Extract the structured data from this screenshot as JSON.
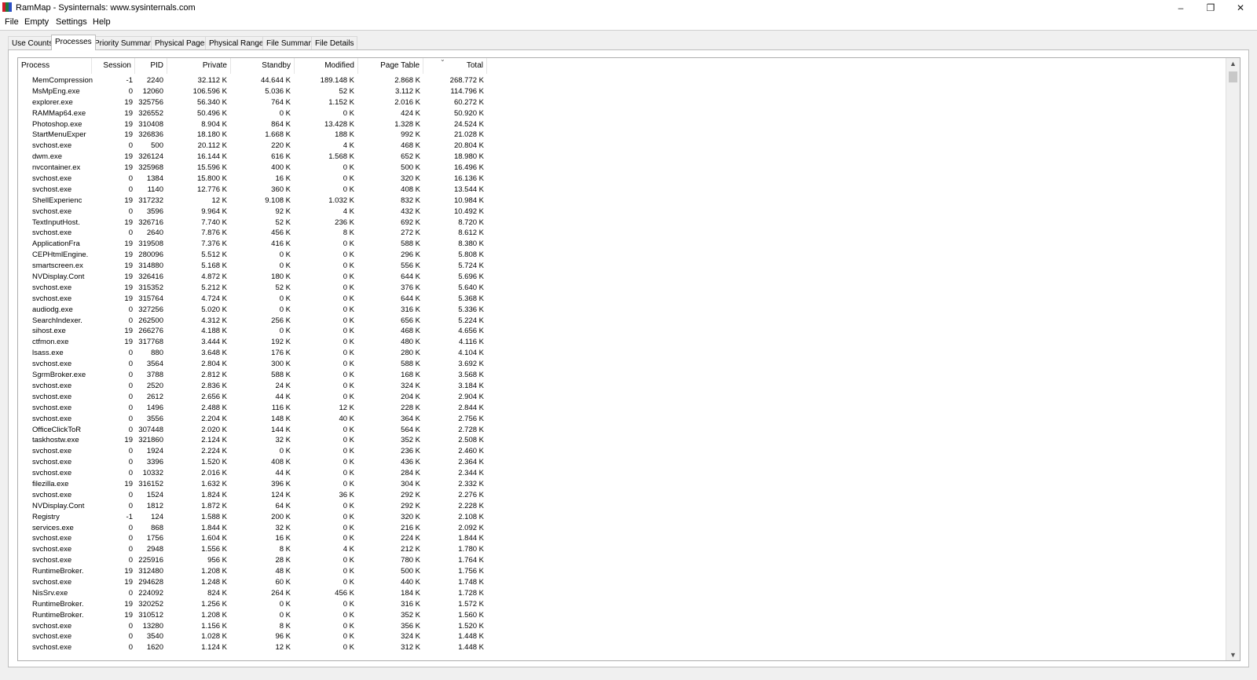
{
  "window": {
    "title": "RamMap - Sysinternals: www.sysinternals.com",
    "minimize_glyph": "–",
    "restore_glyph": "❐",
    "close_glyph": "✕",
    "icon_colors": [
      "#d01c2b",
      "#1f7a3a",
      "#2b4fc4"
    ]
  },
  "menu": [
    "File",
    "Empty",
    "Settings",
    "Help"
  ],
  "tabs": [
    "Use Counts",
    "Processes",
    "Priority Summary",
    "Physical Pages",
    "Physical Ranges",
    "File Summary",
    "File Details"
  ],
  "active_tab": "Processes",
  "table": {
    "columns": [
      "Process",
      "Session",
      "PID",
      "Private",
      "Standby",
      "Modified",
      "Page Table",
      "Total"
    ],
    "sorted_column": "Total",
    "rows": [
      [
        "MemCompression",
        "-1",
        "2240",
        "32.112 K",
        "44.644 K",
        "189.148 K",
        "2.868 K",
        "268.772 K"
      ],
      [
        "MsMpEng.exe",
        "0",
        "12060",
        "106.596 K",
        "5.036 K",
        "52 K",
        "3.112 K",
        "114.796 K"
      ],
      [
        "explorer.exe",
        "19",
        "325756",
        "56.340 K",
        "764 K",
        "1.152 K",
        "2.016 K",
        "60.272 K"
      ],
      [
        "RAMMap64.exe",
        "19",
        "326552",
        "50.496 K",
        "0 K",
        "0 K",
        "424 K",
        "50.920 K"
      ],
      [
        "Photoshop.exe",
        "19",
        "310408",
        "8.904 K",
        "864 K",
        "13.428 K",
        "1.328 K",
        "24.524 K"
      ],
      [
        "StartMenuExper",
        "19",
        "326836",
        "18.180 K",
        "1.668 K",
        "188 K",
        "992 K",
        "21.028 K"
      ],
      [
        "svchost.exe",
        "0",
        "500",
        "20.112 K",
        "220 K",
        "4 K",
        "468 K",
        "20.804 K"
      ],
      [
        "dwm.exe",
        "19",
        "326124",
        "16.144 K",
        "616 K",
        "1.568 K",
        "652 K",
        "18.980 K"
      ],
      [
        "nvcontainer.ex",
        "19",
        "325968",
        "15.596 K",
        "400 K",
        "0 K",
        "500 K",
        "16.496 K"
      ],
      [
        "svchost.exe",
        "0",
        "1384",
        "15.800 K",
        "16 K",
        "0 K",
        "320 K",
        "16.136 K"
      ],
      [
        "svchost.exe",
        "0",
        "1140",
        "12.776 K",
        "360 K",
        "0 K",
        "408 K",
        "13.544 K"
      ],
      [
        "ShellExperienc",
        "19",
        "317232",
        "12 K",
        "9.108 K",
        "1.032 K",
        "832 K",
        "10.984 K"
      ],
      [
        "svchost.exe",
        "0",
        "3596",
        "9.964 K",
        "92 K",
        "4 K",
        "432 K",
        "10.492 K"
      ],
      [
        "TextInputHost.",
        "19",
        "326716",
        "7.740 K",
        "52 K",
        "236 K",
        "692 K",
        "8.720 K"
      ],
      [
        "svchost.exe",
        "0",
        "2640",
        "7.876 K",
        "456 K",
        "8 K",
        "272 K",
        "8.612 K"
      ],
      [
        "ApplicationFra",
        "19",
        "319508",
        "7.376 K",
        "416 K",
        "0 K",
        "588 K",
        "8.380 K"
      ],
      [
        "CEPHtmlEngine.",
        "19",
        "280096",
        "5.512 K",
        "0 K",
        "0 K",
        "296 K",
        "5.808 K"
      ],
      [
        "smartscreen.ex",
        "19",
        "314880",
        "5.168 K",
        "0 K",
        "0 K",
        "556 K",
        "5.724 K"
      ],
      [
        "NVDisplay.Cont",
        "19",
        "326416",
        "4.872 K",
        "180 K",
        "0 K",
        "644 K",
        "5.696 K"
      ],
      [
        "svchost.exe",
        "19",
        "315352",
        "5.212 K",
        "52 K",
        "0 K",
        "376 K",
        "5.640 K"
      ],
      [
        "svchost.exe",
        "19",
        "315764",
        "4.724 K",
        "0 K",
        "0 K",
        "644 K",
        "5.368 K"
      ],
      [
        "audiodg.exe",
        "0",
        "327256",
        "5.020 K",
        "0 K",
        "0 K",
        "316 K",
        "5.336 K"
      ],
      [
        "SearchIndexer.",
        "0",
        "262500",
        "4.312 K",
        "256 K",
        "0 K",
        "656 K",
        "5.224 K"
      ],
      [
        "sihost.exe",
        "19",
        "266276",
        "4.188 K",
        "0 K",
        "0 K",
        "468 K",
        "4.656 K"
      ],
      [
        "ctfmon.exe",
        "19",
        "317768",
        "3.444 K",
        "192 K",
        "0 K",
        "480 K",
        "4.116 K"
      ],
      [
        "lsass.exe",
        "0",
        "880",
        "3.648 K",
        "176 K",
        "0 K",
        "280 K",
        "4.104 K"
      ],
      [
        "svchost.exe",
        "0",
        "3564",
        "2.804 K",
        "300 K",
        "0 K",
        "588 K",
        "3.692 K"
      ],
      [
        "SgrmBroker.exe",
        "0",
        "3788",
        "2.812 K",
        "588 K",
        "0 K",
        "168 K",
        "3.568 K"
      ],
      [
        "svchost.exe",
        "0",
        "2520",
        "2.836 K",
        "24 K",
        "0 K",
        "324 K",
        "3.184 K"
      ],
      [
        "svchost.exe",
        "0",
        "2612",
        "2.656 K",
        "44 K",
        "0 K",
        "204 K",
        "2.904 K"
      ],
      [
        "svchost.exe",
        "0",
        "1496",
        "2.488 K",
        "116 K",
        "12 K",
        "228 K",
        "2.844 K"
      ],
      [
        "svchost.exe",
        "0",
        "3556",
        "2.204 K",
        "148 K",
        "40 K",
        "364 K",
        "2.756 K"
      ],
      [
        "OfficeClickToR",
        "0",
        "307448",
        "2.020 K",
        "144 K",
        "0 K",
        "564 K",
        "2.728 K"
      ],
      [
        "taskhostw.exe",
        "19",
        "321860",
        "2.124 K",
        "32 K",
        "0 K",
        "352 K",
        "2.508 K"
      ],
      [
        "svchost.exe",
        "0",
        "1924",
        "2.224 K",
        "0 K",
        "0 K",
        "236 K",
        "2.460 K"
      ],
      [
        "svchost.exe",
        "0",
        "3396",
        "1.520 K",
        "408 K",
        "0 K",
        "436 K",
        "2.364 K"
      ],
      [
        "svchost.exe",
        "0",
        "10332",
        "2.016 K",
        "44 K",
        "0 K",
        "284 K",
        "2.344 K"
      ],
      [
        "filezilla.exe",
        "19",
        "316152",
        "1.632 K",
        "396 K",
        "0 K",
        "304 K",
        "2.332 K"
      ],
      [
        "svchost.exe",
        "0",
        "1524",
        "1.824 K",
        "124 K",
        "36 K",
        "292 K",
        "2.276 K"
      ],
      [
        "NVDisplay.Cont",
        "0",
        "1812",
        "1.872 K",
        "64 K",
        "0 K",
        "292 K",
        "2.228 K"
      ],
      [
        "Registry",
        "-1",
        "124",
        "1.588 K",
        "200 K",
        "0 K",
        "320 K",
        "2.108 K"
      ],
      [
        "services.exe",
        "0",
        "868",
        "1.844 K",
        "32 K",
        "0 K",
        "216 K",
        "2.092 K"
      ],
      [
        "svchost.exe",
        "0",
        "1756",
        "1.604 K",
        "16 K",
        "0 K",
        "224 K",
        "1.844 K"
      ],
      [
        "svchost.exe",
        "0",
        "2948",
        "1.556 K",
        "8 K",
        "4 K",
        "212 K",
        "1.780 K"
      ],
      [
        "svchost.exe",
        "0",
        "225916",
        "956 K",
        "28 K",
        "0 K",
        "780 K",
        "1.764 K"
      ],
      [
        "RuntimeBroker.",
        "19",
        "312480",
        "1.208 K",
        "48 K",
        "0 K",
        "500 K",
        "1.756 K"
      ],
      [
        "svchost.exe",
        "19",
        "294628",
        "1.248 K",
        "60 K",
        "0 K",
        "440 K",
        "1.748 K"
      ],
      [
        "NisSrv.exe",
        "0",
        "224092",
        "824 K",
        "264 K",
        "456 K",
        "184 K",
        "1.728 K"
      ],
      [
        "RuntimeBroker.",
        "19",
        "320252",
        "1.256 K",
        "0 K",
        "0 K",
        "316 K",
        "1.572 K"
      ],
      [
        "RuntimeBroker.",
        "19",
        "310512",
        "1.208 K",
        "0 K",
        "0 K",
        "352 K",
        "1.560 K"
      ],
      [
        "svchost.exe",
        "0",
        "13280",
        "1.156 K",
        "8 K",
        "0 K",
        "356 K",
        "1.520 K"
      ],
      [
        "svchost.exe",
        "0",
        "3540",
        "1.028 K",
        "96 K",
        "0 K",
        "324 K",
        "1.448 K"
      ],
      [
        "svchost.exe",
        "0",
        "1620",
        "1.124 K",
        "12 K",
        "0 K",
        "312 K",
        "1.448 K"
      ]
    ]
  },
  "scrollbar": {
    "up_glyph": "▲",
    "down_glyph": "▼"
  }
}
